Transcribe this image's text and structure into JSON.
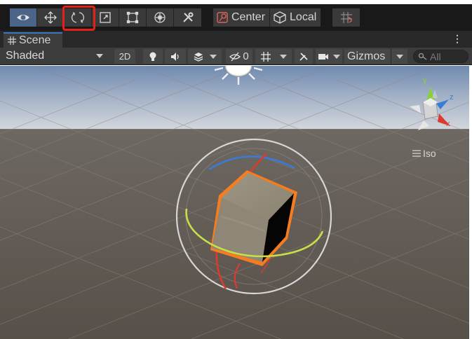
{
  "main_toolbar": {
    "tools": [
      {
        "name": "view-tool",
        "icon": "eye-icon",
        "active": true
      },
      {
        "name": "move-tool",
        "icon": "move-arrows-icon",
        "active": false
      },
      {
        "name": "rotate-tool",
        "icon": "rotate-icon",
        "active": false
      },
      {
        "name": "scale-tool",
        "icon": "scale-icon",
        "active": false
      },
      {
        "name": "rect-tool",
        "icon": "rect-transform-icon",
        "active": false
      },
      {
        "name": "transform-tool",
        "icon": "transform-icon",
        "active": false
      },
      {
        "name": "custom-tool",
        "icon": "wrench-tools-icon",
        "active": false
      }
    ],
    "pivot_mode_label": "Center",
    "pivot_rotation_label": "Local",
    "highlight_color": "#e3201b",
    "active_color": "#4a6587"
  },
  "tab": {
    "label": "Scene",
    "icon": "grid-hash-icon"
  },
  "scene_toolbar": {
    "draw_mode": "Shaded",
    "mode_2d": "2D",
    "hidden_count": "0",
    "gizmos_label": "Gizmos",
    "search_placeholder": "All"
  },
  "viewport": {
    "iso_label": "Iso",
    "axis_labels": {
      "x": "x",
      "y": "y",
      "z": "z"
    },
    "sky_color": "#b8c4d6",
    "ground_color": "#5a544e",
    "axis_colors": {
      "x": "#db3a2f",
      "y": "#8ccf3c",
      "z": "#3a7bd5"
    },
    "selection_color": "#f57c1f"
  }
}
